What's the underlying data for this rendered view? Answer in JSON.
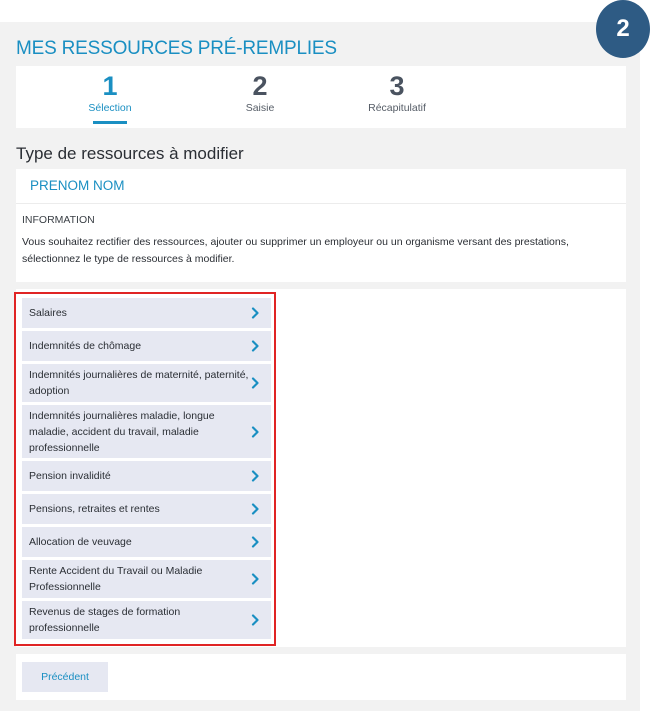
{
  "badge": "2",
  "page_title": "MES RESSOURCES PRÉ-REMPLIES",
  "steps": [
    {
      "num": "1",
      "label": "Sélection"
    },
    {
      "num": "2",
      "label": "Saisie"
    },
    {
      "num": "3",
      "label": "Récapitulatif"
    }
  ],
  "active_step": 1,
  "section_title": "Type de ressources à modifier",
  "person_name": "PRENOM NOM",
  "info": {
    "heading": "INFORMATION",
    "text": "Vous souhaitez rectifier des ressources, ajouter ou supprimer un employeur ou un organisme versant des prestations, sélectionnez le type de ressources à modifier."
  },
  "resource_types": [
    {
      "label": "Salaires",
      "icon": "chevron-right-icon"
    },
    {
      "label": "Indemnités de chômage",
      "icon": "chevron-right-icon"
    },
    {
      "label": "Indemnités journalières de maternité, paternité, adoption",
      "icon": "chevron-right-icon"
    },
    {
      "label": "Indemnités journalières maladie, longue maladie, accident du travail, maladie professionnelle",
      "icon": "chevron-right-icon"
    },
    {
      "label": "Pension invalidité",
      "icon": "chevron-right-icon"
    },
    {
      "label": "Pensions, retraites et rentes",
      "icon": "chevron-right-icon"
    },
    {
      "label": "Allocation de veuvage",
      "icon": "chevron-right-icon"
    },
    {
      "label": "Rente Accident du Travail ou Maladie Professionnelle",
      "icon": "chevron-right-icon"
    },
    {
      "label": "Revenus de stages de formation professionnelle",
      "icon": "chevron-right-icon"
    }
  ],
  "buttons": {
    "previous": "Précédent"
  },
  "colors": {
    "accent": "#1a8fc2",
    "badge": "#2e5b84",
    "item_bg": "#e6e8f2",
    "highlight_border": "#e02424"
  }
}
